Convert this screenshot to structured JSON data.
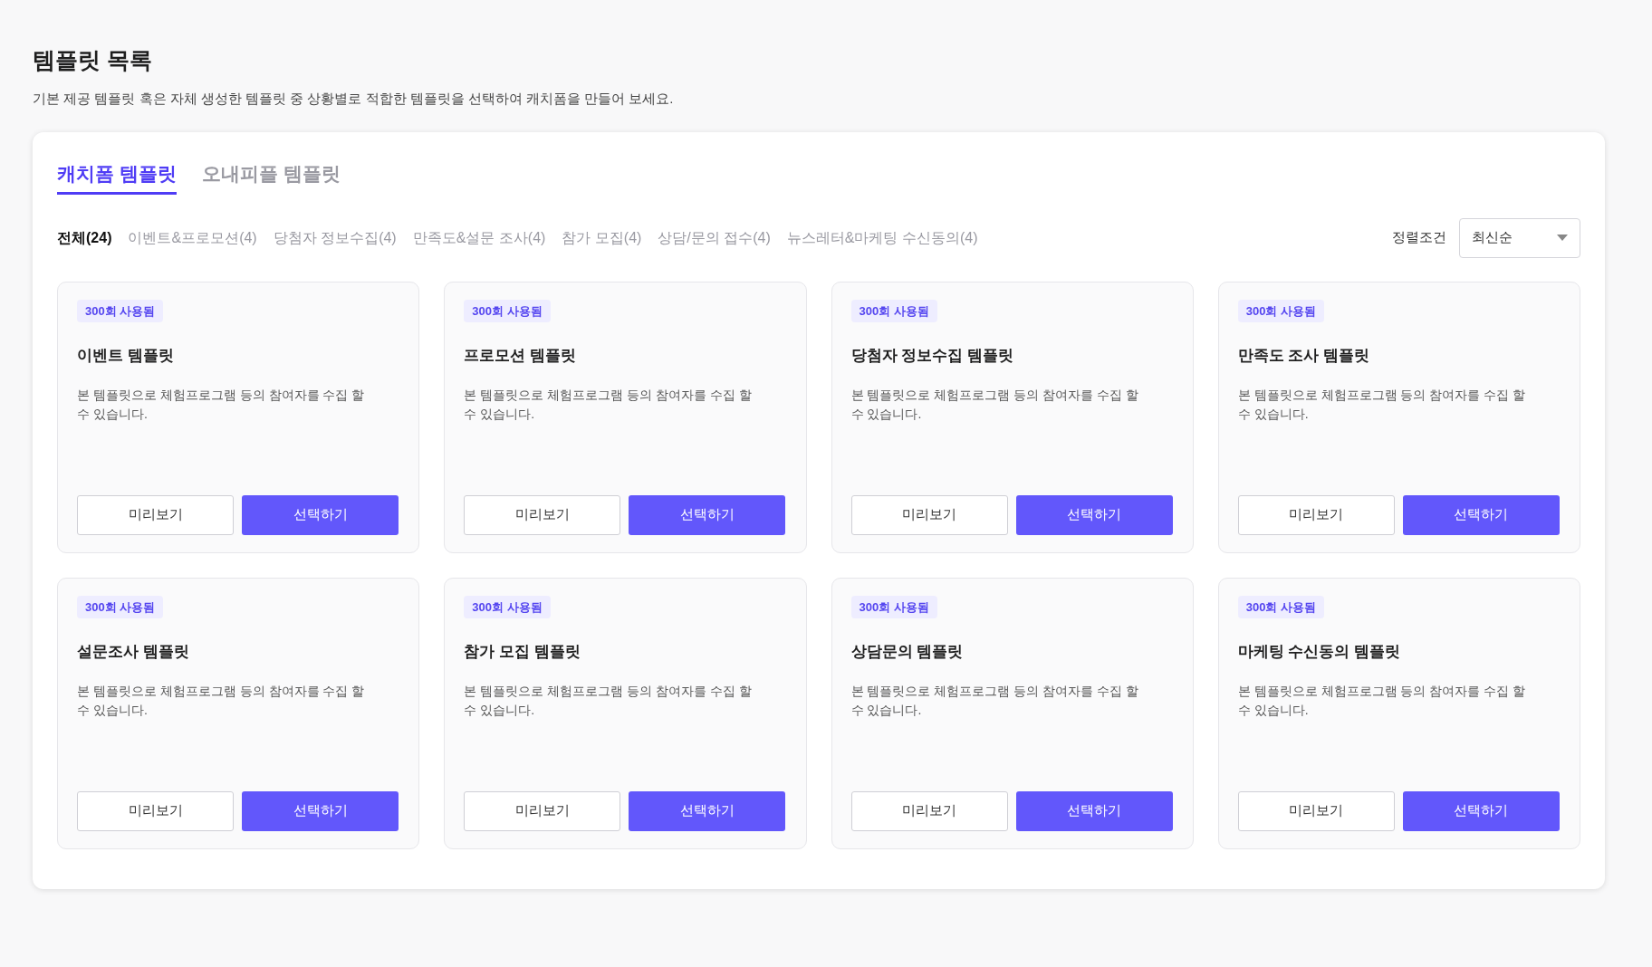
{
  "page": {
    "title": "템플릿 목록",
    "description": "기본 제공 템플릿 혹은 자체 생성한 템플릿 중 상황별로 적합한 템플릿을 선택하여 캐치폼을 만들어 보세요."
  },
  "tabs": [
    {
      "label": "캐치폼 템플릿",
      "selected": true
    },
    {
      "label": "오내피플 템플릿",
      "selected": false
    }
  ],
  "filters": [
    {
      "label": "전체(24)",
      "selected": true
    },
    {
      "label": "이벤트&프로모션(4)",
      "selected": false
    },
    {
      "label": "당첨자 정보수집(4)",
      "selected": false
    },
    {
      "label": "만족도&설문 조사(4)",
      "selected": false
    },
    {
      "label": "참가 모집(4)",
      "selected": false
    },
    {
      "label": "상담/문의 접수(4)",
      "selected": false
    },
    {
      "label": "뉴스레터&마케팅 수신동의(4)",
      "selected": false
    }
  ],
  "sort": {
    "label": "정렬조건",
    "value": "최신순"
  },
  "cards": [
    {
      "badge": "300회 사용됨",
      "title": "이벤트 템플릿",
      "description": "본 템플릿으로 체험프로그램 등의 참여자를 수집 할 수 있습니다.",
      "preview": "미리보기",
      "select": "선택하기"
    },
    {
      "badge": "300회 사용됨",
      "title": "프로모션 템플릿",
      "description": "본 템플릿으로 체험프로그램 등의 참여자를 수집 할 수 있습니다.",
      "preview": "미리보기",
      "select": "선택하기"
    },
    {
      "badge": "300회 사용됨",
      "title": "당첨자 정보수집 템플릿",
      "description": "본 템플릿으로 체험프로그램 등의 참여자를 수집 할 수 있습니다.",
      "preview": "미리보기",
      "select": "선택하기"
    },
    {
      "badge": "300회 사용됨",
      "title": "만족도 조사 템플릿",
      "description": "본 템플릿으로 체험프로그램 등의 참여자를 수집 할 수 있습니다.",
      "preview": "미리보기",
      "select": "선택하기"
    },
    {
      "badge": "300회 사용됨",
      "title": "설문조사 템플릿",
      "description": "본 템플릿으로 체험프로그램 등의 참여자를 수집 할 수 있습니다.",
      "preview": "미리보기",
      "select": "선택하기"
    },
    {
      "badge": "300회 사용됨",
      "title": "참가 모집 템플릿",
      "description": "본 템플릿으로 체험프로그램 등의 참여자를 수집 할 수 있습니다.",
      "preview": "미리보기",
      "select": "선택하기"
    },
    {
      "badge": "300회 사용됨",
      "title": "상담문의 템플릿",
      "description": "본 템플릿으로 체험프로그램 등의 참여자를 수집 할 수 있습니다.",
      "preview": "미리보기",
      "select": "선택하기"
    },
    {
      "badge": "300회 사용됨",
      "title": "마케팅 수신동의 템플릿",
      "description": "본 템플릿으로 체험프로그램 등의 참여자를 수집 할 수 있습니다.",
      "preview": "미리보기",
      "select": "선택하기"
    }
  ]
}
